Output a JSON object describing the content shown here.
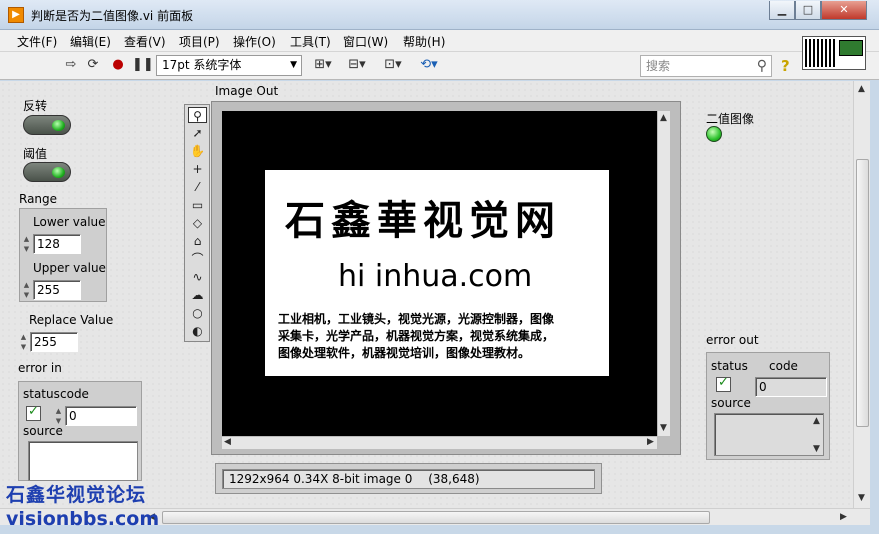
{
  "window": {
    "title": "判断是否为二值图像.vi 前面板",
    "minimize": "▁",
    "maximize": "□",
    "close": "✕"
  },
  "menu": [
    "文件(F)",
    "编辑(E)",
    "查看(V)",
    "项目(P)",
    "操作(O)",
    "工具(T)",
    "窗口(W)",
    "帮助(H)"
  ],
  "toolbar": {
    "font": "17pt 系统字体",
    "search_placeholder": "搜索"
  },
  "controls": {
    "invert_label": "反转",
    "threshold_label": "阈值",
    "range_label": "Range",
    "lower_label": "Lower value",
    "lower_value": "128",
    "upper_label": "Upper value",
    "upper_value": "255",
    "replace_label": "Replace Value",
    "replace_value": "255",
    "error_in_label": "error in",
    "error_in_status": "status",
    "error_in_code_label": "code",
    "error_in_code": "0",
    "error_in_source": "source"
  },
  "image": {
    "label": "Image Out",
    "calligraphy": "石鑫華视觉网",
    "url": "hi inhua.com",
    "body_lines": [
      "工业相机，工业镜头，视觉光源，光源控制器，图像",
      "采集卡，光学产品，机器视觉方案，视觉系统集成，",
      "图像处理软件，机器视觉培训，图像处理教材。"
    ],
    "status_info": "1292x964 0.34X 8-bit image 0",
    "status_coord": "(38,648)"
  },
  "indicators": {
    "binary_label": "二值图像",
    "error_out_label": "error out",
    "error_out_status": "status",
    "error_out_code_label": "code",
    "error_out_code": "0",
    "error_out_source": "source"
  },
  "watermark": {
    "line1": "石鑫华视觉论坛",
    "line2": "visionbbs.com"
  }
}
